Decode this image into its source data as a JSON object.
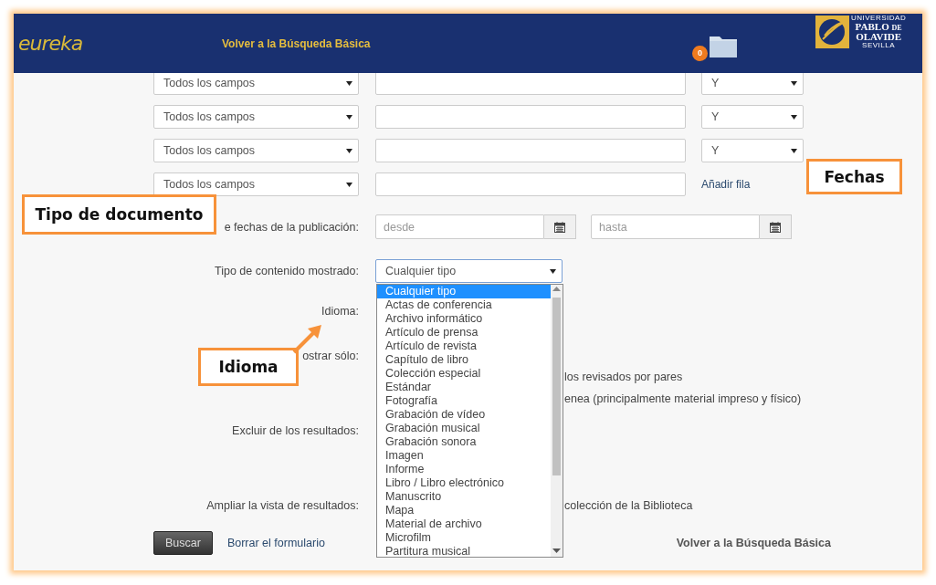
{
  "header": {
    "logo": "eureka",
    "back_link": "Volver a la Búsqueda Básica",
    "basket_count": "0",
    "university": {
      "top": "UNIVERSIDAD",
      "name_1": "PABLO",
      "joiner": "DE",
      "name_2": "OLAVIDE",
      "city": "SEVILLA"
    }
  },
  "search_rows": [
    {
      "field": "Todos los campos",
      "operator": "Y"
    },
    {
      "field": "Todos los campos",
      "operator": "Y"
    },
    {
      "field": "Todos los campos",
      "operator": "Y"
    },
    {
      "field": "Todos los campos"
    }
  ],
  "add_row_link": "Añadir fila",
  "date_range": {
    "label": "e fechas de la publicación:",
    "from_placeholder": "desde",
    "to_placeholder": "hasta"
  },
  "content_type": {
    "label": "Tipo de contenido mostrado:",
    "value": "Cualquier tipo",
    "options": [
      {
        "label": "Cualquier tipo",
        "selected": true
      },
      {
        "label": "Actas de conferencia",
        "selected": false
      },
      {
        "label": "Archivo informático",
        "selected": false
      },
      {
        "label": "Artículo de prensa",
        "selected": false
      },
      {
        "label": "Artículo de revista",
        "selected": false
      },
      {
        "label": "Capítulo de libro",
        "selected": false
      },
      {
        "label": "Colección especial",
        "selected": false
      },
      {
        "label": "Estándar",
        "selected": false
      },
      {
        "label": "Fotografía",
        "selected": false
      },
      {
        "label": "Grabación de vídeo",
        "selected": false
      },
      {
        "label": "Grabación musical",
        "selected": false
      },
      {
        "label": "Grabación sonora",
        "selected": false
      },
      {
        "label": "Imagen",
        "selected": false
      },
      {
        "label": "Informe",
        "selected": false
      },
      {
        "label": "Libro / Libro electrónico",
        "selected": false
      },
      {
        "label": "Manuscrito",
        "selected": false
      },
      {
        "label": "Mapa",
        "selected": false
      },
      {
        "label": "Material de archivo",
        "selected": false
      },
      {
        "label": "Microfilm",
        "selected": false
      },
      {
        "label": "Partitura musical",
        "selected": false
      }
    ]
  },
  "language_label": "Idioma:",
  "show_only": {
    "label": "ostrar sólo:",
    "options": [
      "los revisados por pares",
      "enea (principalmente material impreso y físico)"
    ]
  },
  "exclude_label": "Excluir de los resultados:",
  "expand": {
    "label": "Ampliar la vista de resultados:",
    "option": "colección de la Biblioteca"
  },
  "actions": {
    "search": "Buscar",
    "clear": "Borrar el formulario",
    "back": "Volver a la Búsqueda Básica"
  },
  "annotations": [
    {
      "text": "Tipo de documento"
    },
    {
      "text": "Fechas"
    },
    {
      "text": "Idioma",
      "arrow": true
    }
  ]
}
